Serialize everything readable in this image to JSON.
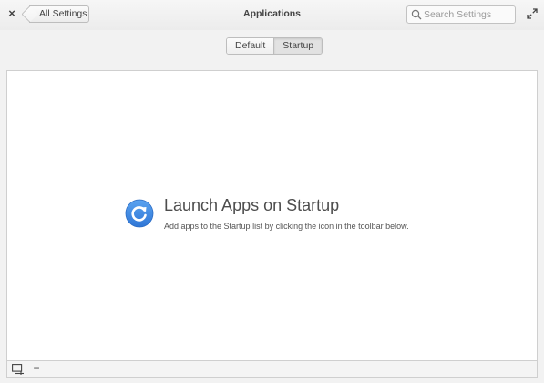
{
  "header": {
    "close_glyph": "×",
    "back_label": "All Settings",
    "title": "Applications",
    "search_placeholder": "Search Settings",
    "search_value": ""
  },
  "modes": {
    "items": [
      {
        "label": "Default",
        "active": false
      },
      {
        "label": "Startup",
        "active": true
      }
    ]
  },
  "placeholder": {
    "icon": "refresh-circle-icon",
    "icon_color": "#3689e6",
    "title": "Launch Apps on Startup",
    "subtitle": "Add apps to the Startup list by clicking the icon in the toolbar below."
  },
  "toolbar": {
    "add_icon": "add-app-icon",
    "remove_glyph": "−"
  }
}
